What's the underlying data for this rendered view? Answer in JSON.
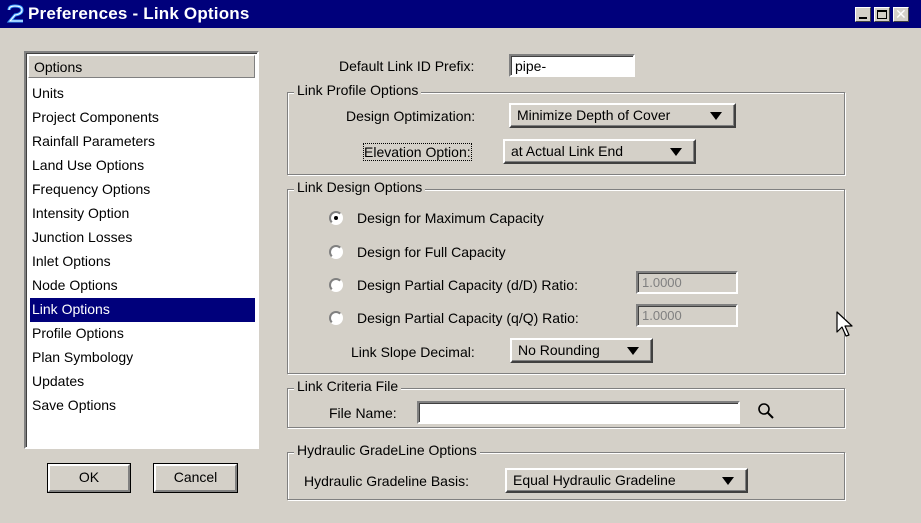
{
  "window": {
    "title": "Preferences - Link Options"
  },
  "options_list": {
    "header": "Options",
    "items": [
      "Units",
      "Project Components",
      "Rainfall Parameters",
      "Land Use Options",
      "Frequency Options",
      "Intensity Option",
      "Junction Losses",
      "Inlet Options",
      "Node Options",
      "Link Options",
      "Profile Options",
      "Plan Symbology",
      "Updates",
      "Save Options"
    ],
    "selected": "Link Options"
  },
  "buttons": {
    "ok": "OK",
    "cancel": "Cancel"
  },
  "default_prefix": {
    "label": "Default Link ID Prefix:",
    "value": "pipe-"
  },
  "link_profile": {
    "legend": "Link Profile Options",
    "design_optimization_label": "Design Optimization:",
    "design_optimization_value": "Minimize Depth of Cover",
    "elevation_option_label": "Elevation Option:",
    "elevation_option_value": "at Actual Link End"
  },
  "link_design": {
    "legend": "Link Design Options",
    "radios": [
      {
        "label": "Design for Maximum Capacity",
        "checked": true
      },
      {
        "label": "Design for Full Capacity",
        "checked": false
      },
      {
        "label": "Design Partial Capacity (d/D) Ratio:",
        "checked": false,
        "value": "1.0000"
      },
      {
        "label": "Design Partial Capacity (q/Q) Ratio:",
        "checked": false,
        "value": "1.0000"
      }
    ],
    "slope_label": "Link Slope Decimal:",
    "slope_value": "No Rounding"
  },
  "criteria": {
    "legend": "Link Criteria File",
    "file_label": "File Name:",
    "file_value": ""
  },
  "hgl": {
    "legend": "Hydraulic GradeLine Options",
    "basis_label": "Hydraulic Gradeline Basis:",
    "basis_value": "Equal Hydraulic Gradeline"
  },
  "colors": {
    "titlebar": "#00007b",
    "selection": "#00007b",
    "face": "#d4d0c8"
  },
  "icons": {
    "app": "app-logo-icon",
    "browse": "magnifier-icon",
    "cursor": "mouse-pointer-icon"
  }
}
